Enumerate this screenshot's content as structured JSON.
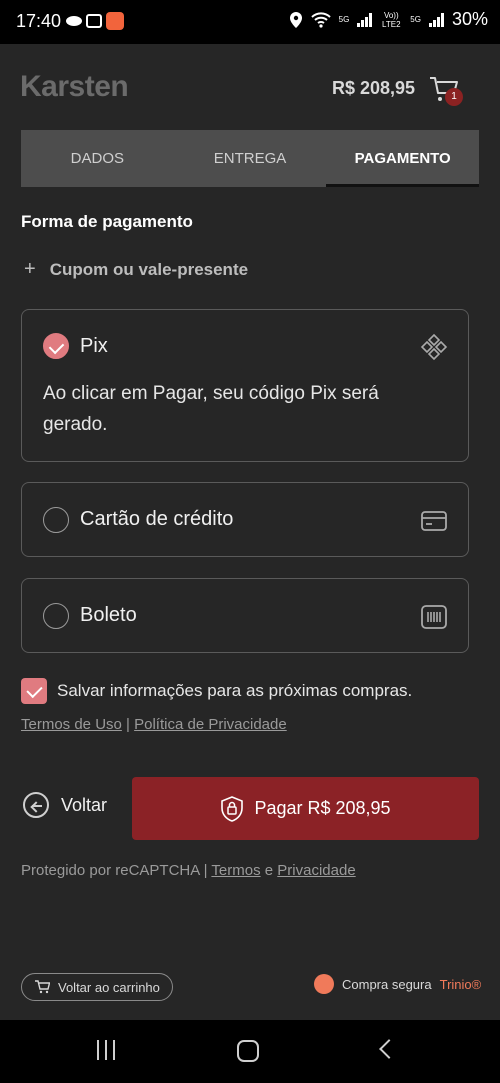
{
  "status_bar": {
    "time": "17:40",
    "network_5g_a": "5G",
    "network_volte": "Vo)) LTE2",
    "network_5g_b": "5G",
    "battery": "30%"
  },
  "header": {
    "logo": "Karsten",
    "cart_total": "R$ 208,95",
    "cart_count": "1"
  },
  "tabs": [
    {
      "label": "DADOS",
      "active": false
    },
    {
      "label": "ENTREGA",
      "active": false
    },
    {
      "label": "PAGAMENTO",
      "active": true
    }
  ],
  "payment": {
    "section_title": "Forma de pagamento",
    "coupon_label": "Cupom ou vale-presente",
    "methods": [
      {
        "label": "Pix",
        "selected": true,
        "icon": "pix-icon",
        "description": "Ao clicar em Pagar, seu código Pix será gerado."
      },
      {
        "label": "Cartão de crédito",
        "selected": false,
        "icon": "credit-card-icon"
      },
      {
        "label": "Boleto",
        "selected": false,
        "icon": "barcode-icon"
      }
    ],
    "save_info_label": "Salvar informações para as próximas compras.",
    "save_info_checked": true,
    "terms_link": "Termos de Uso",
    "separator": "|",
    "privacy_link": "Política de Privacidade"
  },
  "actions": {
    "back_label": "Voltar",
    "pay_label": "Pagar R$ 208,95"
  },
  "recaptcha": {
    "text": "Protegido por reCAPTCHA",
    "separator": "|",
    "terms": "Termos",
    "and": "e",
    "privacy": "Privacidade"
  },
  "footer": {
    "back_to_cart": "Voltar ao carrinho",
    "secure_text": "Compra segura",
    "secure_brand": "Trinio®"
  },
  "colors": {
    "accent": "#8b2226",
    "check": "#e07b80",
    "brand_orange": "#f07a5a"
  }
}
